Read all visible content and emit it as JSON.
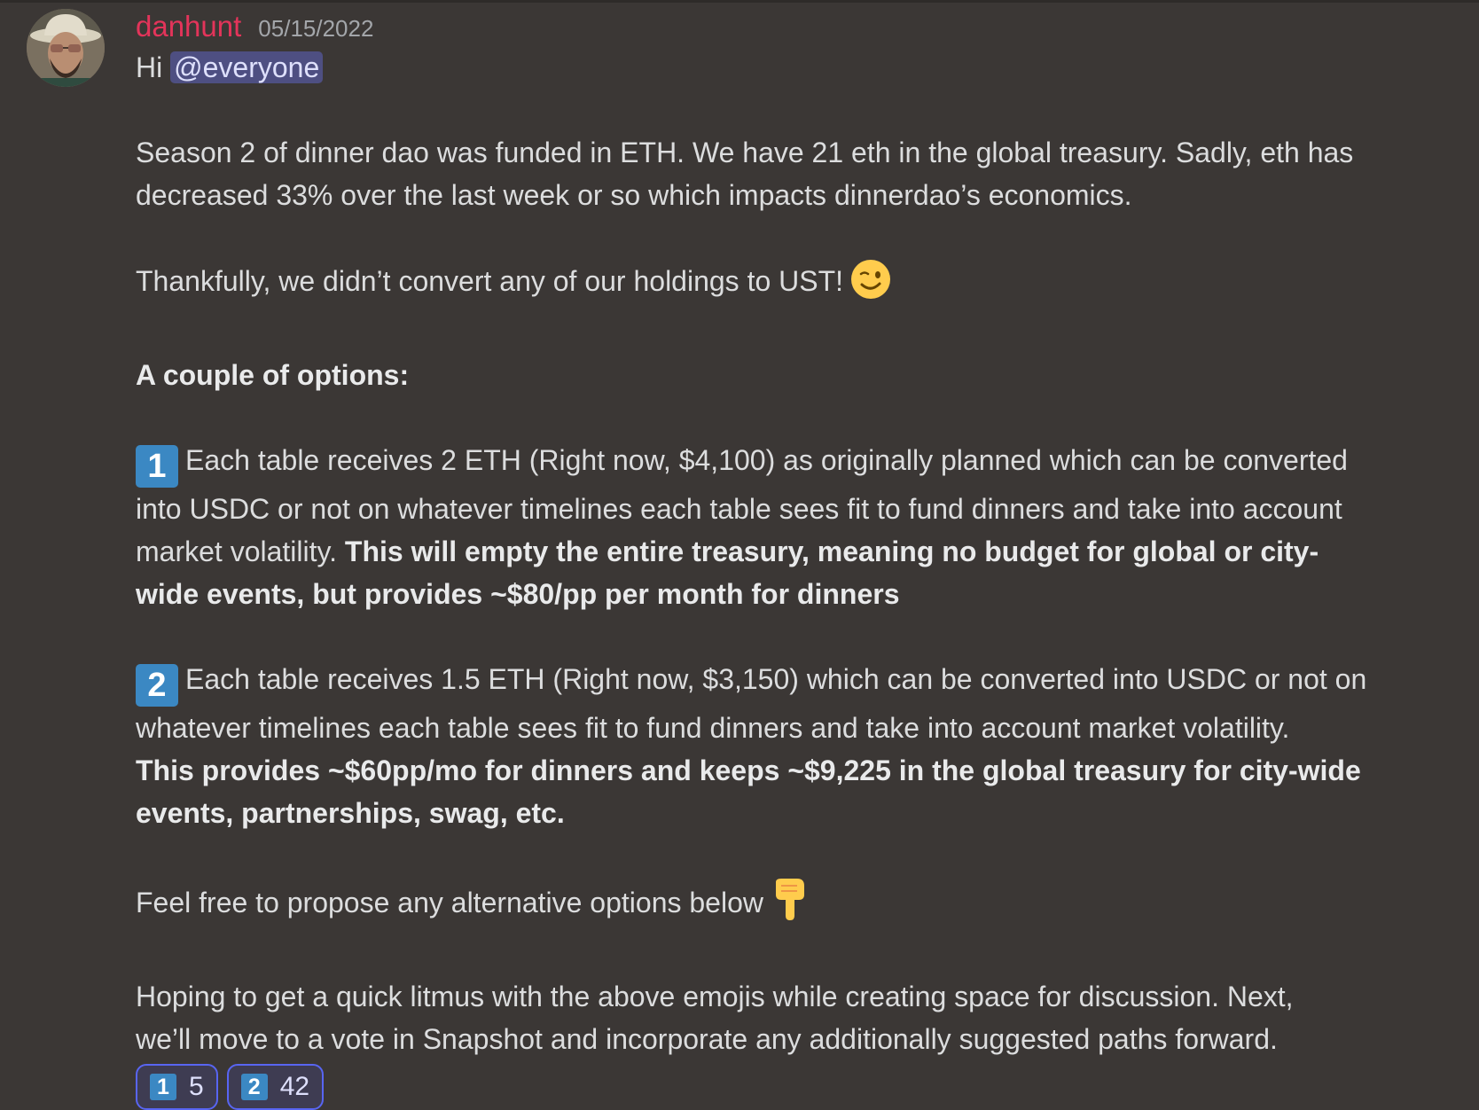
{
  "message": {
    "username": "danhunt",
    "timestamp": "05/15/2022",
    "greeting": "Hi",
    "mention": "@everyone",
    "p1_line1": "Season 2 of dinner dao was funded in ETH. We have 21 eth in the global treasury. Sadly, eth has",
    "p1_line2": "decreased 33% over the last week or so which impacts dinnerdao’s economics.",
    "p2": "Thankfully, we didn’t convert any of our holdings to UST!",
    "options_heading": "A couple of options:",
    "opt1_key": "1",
    "opt1_line1": "Each table receives 2 ETH (Right now, $4,100) as originally planned which can be converted",
    "opt1_line2": "into USDC or not on whatever timelines each table sees fit to fund dinners and take into account",
    "opt1_line3_normal": "market volatility. ",
    "opt1_line3_bold": "This will empty the entire treasury, meaning no budget for global or city-",
    "opt1_line4_bold": "wide events, but provides ~$80/pp per month for dinners",
    "opt2_key": "2",
    "opt2_line1": "Each table receives 1.5 ETH (Right now, $3,150) which can be converted into USDC or not on",
    "opt2_line2": "whatever timelines each table sees fit to fund dinners and take into account market volatility.",
    "opt2_line3_bold": "This provides ~$60pp/mo for dinners and keeps ~$9,225 in the global treasury for city-wide",
    "opt2_line4_bold": "events, partnerships, swag, etc.",
    "p3": "Feel free to propose any alternative options below",
    "p4_line1": "Hoping to get a quick litmus with the above emojis while creating space for discussion. Next,",
    "p4_line2": "we’ll move to a vote in Snapshot and incorporate any additionally suggested paths forward."
  },
  "emojis": {
    "wink": "winking-face-icon",
    "point_down": "backhand-index-pointing-down-icon",
    "keycap_color": "#3b88c3"
  },
  "reactions": [
    {
      "key": "1",
      "count": "5"
    },
    {
      "key": "2",
      "count": "42"
    }
  ],
  "colors": {
    "background": "#3b3735",
    "username": "#e3345a",
    "mention_bg": "#4e4f82",
    "reaction_border": "#5865f2"
  }
}
